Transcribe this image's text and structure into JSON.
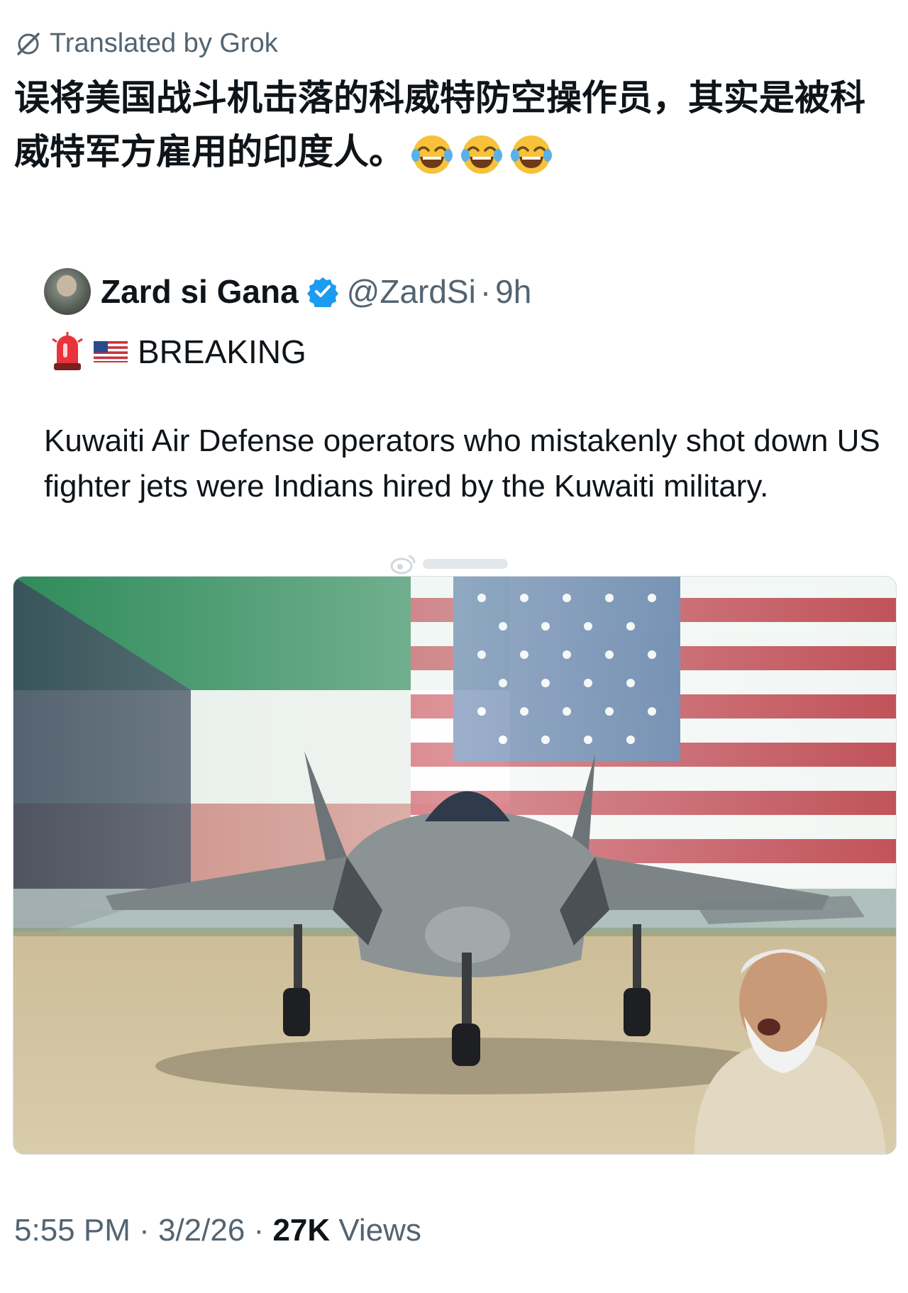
{
  "translation_label": "Translated by Grok",
  "post": {
    "text": "误将美国战斗机击落的科威特防空操作员，其实是被科威特军方雇用的印度人。",
    "emojis": [
      "face-with-tears-of-joy",
      "face-with-tears-of-joy",
      "face-with-tears-of-joy"
    ]
  },
  "quoted": {
    "author": "Zard si Gana",
    "handle": "@ZardSi",
    "separator": "·",
    "time_ago": "9h",
    "breaking_label": "BREAKING",
    "breaking_icons": [
      "police-light-icon",
      "us-flag-icon"
    ],
    "text": "Kuwaiti Air Defense operators who mistakenly shot down US fighter jets were Indians hired by the Kuwaiti military."
  },
  "meta": {
    "time": "5:55 PM",
    "sep1": " · ",
    "date": "3/2/26",
    "sep2": " · ",
    "views_count": "27K",
    "views_label": " Views"
  },
  "colors": {
    "text": "#0f1419",
    "secondary": "#536471",
    "verified_blue": "#1d9bf0",
    "kuwait_green": "#1f8a4c",
    "kuwait_red": "#c8343a",
    "us_blue": "#2a4b8d"
  }
}
